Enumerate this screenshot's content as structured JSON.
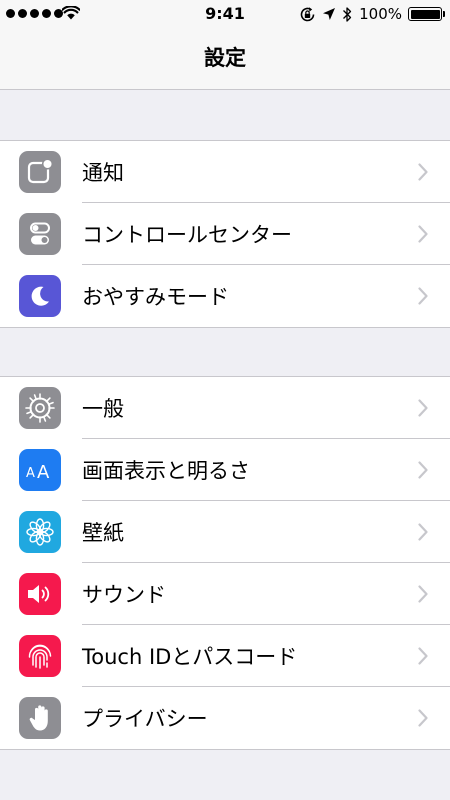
{
  "status_bar": {
    "time": "9:41",
    "battery_percent": "100%",
    "signal_bars": 5,
    "battery_level": 1.0
  },
  "nav": {
    "title": "設定"
  },
  "groups": [
    {
      "items": [
        {
          "label": "通知",
          "icon": "notifications-icon",
          "color": "#8e8e93"
        },
        {
          "label": "コントロールセンター",
          "icon": "control-center-icon",
          "color": "#8e8e93"
        },
        {
          "label": "おやすみモード",
          "icon": "moon-icon",
          "color": "#5856d6"
        }
      ]
    },
    {
      "items": [
        {
          "label": "一般",
          "icon": "gear-icon",
          "color": "#8e8e93"
        },
        {
          "label": "画面表示と明るさ",
          "icon": "text-size-icon",
          "color": "#1e7cf2"
        },
        {
          "label": "壁紙",
          "icon": "flower-icon",
          "color": "#20a8e0"
        },
        {
          "label": "サウンド",
          "icon": "speaker-icon",
          "color": "#f5194d"
        },
        {
          "label": "Touch IDとパスコード",
          "icon": "fingerprint-icon",
          "color": "#f5194d"
        },
        {
          "label": "プライバシー",
          "icon": "hand-icon",
          "color": "#8e8e93"
        }
      ]
    }
  ]
}
